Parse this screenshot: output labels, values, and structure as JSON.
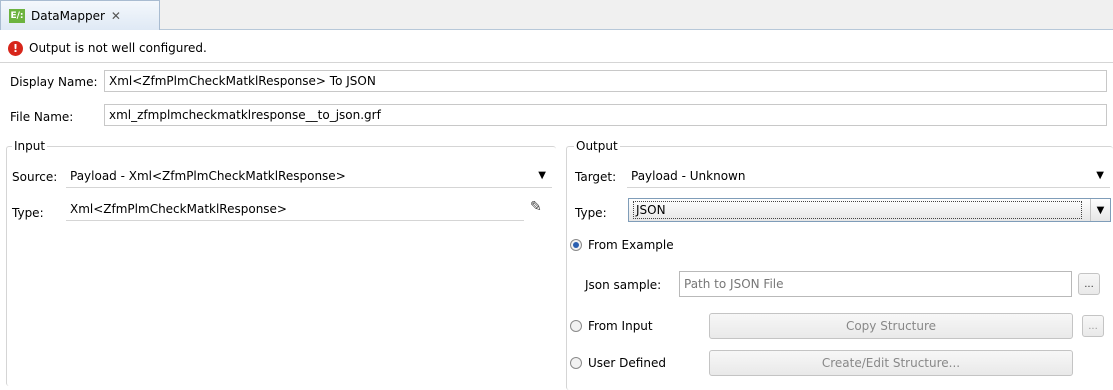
{
  "tab": {
    "title": "DataMapper",
    "icon": "datamapper-icon",
    "close": "✕"
  },
  "status": {
    "message": "Output is not well configured.",
    "icon": "error-icon"
  },
  "display_name": {
    "label": "Display Name:",
    "value": "Xml<ZfmPlmCheckMatklResponse> To JSON"
  },
  "file_name": {
    "label": "File Name:",
    "value": "xml_zfmplmcheckmatklresponse__to_json.grf"
  },
  "input": {
    "title": "Input",
    "source_label": "Source:",
    "source_value": "Payload - Xml<ZfmPlmCheckMatklResponse>",
    "type_label": "Type:",
    "type_value": "Xml<ZfmPlmCheckMatklResponse>",
    "edit_icon": "edit-icon"
  },
  "output": {
    "title": "Output",
    "target_label": "Target:",
    "target_value": "Payload - Unknown",
    "type_label": "Type:",
    "type_value": "JSON",
    "from_example_label": "From Example",
    "json_sample_label": "Json sample:",
    "json_sample_placeholder": "Path to JSON File",
    "browse_label": "...",
    "from_input_label": "From Input",
    "copy_structure_label": "Copy Structure",
    "copy_browse_label": "...",
    "user_defined_label": "User Defined",
    "create_edit_label": "Create/Edit Structure..."
  },
  "colors": {
    "error": "#d7261b",
    "accent": "#2a5fb0",
    "tab_icon": "#6cb33f"
  }
}
